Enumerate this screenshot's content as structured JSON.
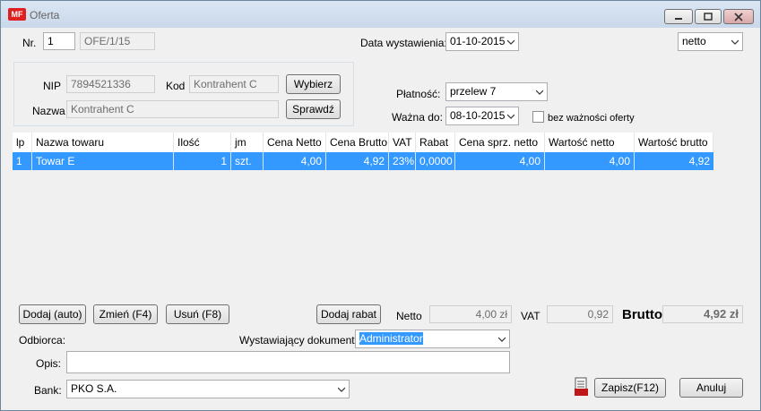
{
  "window": {
    "title": "Oferta",
    "app_icon": "MF"
  },
  "header": {
    "nr_label": "Nr.",
    "nr_value": "1",
    "doc_number": "OFE/1/15",
    "date_label": "Data wystawienia:",
    "date_value": "01-10-2015",
    "price_mode": "netto"
  },
  "contractor": {
    "nip_label": "NIP",
    "nip_value": "7894521336",
    "kod_label": "Kod",
    "kod_value": "Kontrahent C",
    "nazwa_label": "Nazwa",
    "nazwa_value": "Kontrahent C",
    "select_button": "Wybierz",
    "check_button": "Sprawdź"
  },
  "payment": {
    "label": "Płatność:",
    "value": "przelew 7",
    "valid_label": "Ważna do:",
    "valid_value": "08-10-2015",
    "no_expiry_label": "bez ważności oferty"
  },
  "table": {
    "columns": [
      "lp",
      "Nazwa towaru",
      "Ilość",
      "jm",
      "Cena Netto",
      "Cena Brutto",
      "VAT",
      "Rabat",
      "Cena sprz. netto",
      "Wartość netto",
      "Wartość brutto"
    ],
    "rows": [
      [
        "1",
        "Towar E",
        "1",
        "szt.",
        "4,00",
        "4,92",
        "23%",
        "0,0000",
        "4,00",
        "4,00",
        "4,92"
      ]
    ]
  },
  "actions": {
    "add_auto": "Dodaj (auto)",
    "edit": "Zmień (F4)",
    "delete": "Usuń (F8)",
    "add_discount": "Dodaj rabat"
  },
  "totals": {
    "netto_label": "Netto",
    "netto_value": "4,00 zł",
    "vat_label": "VAT",
    "vat_value": "0,92",
    "brutto_label": "Brutto",
    "brutto_value": "4,92 zł"
  },
  "footer": {
    "recipient_label": "Odbiorca:",
    "issuer_label": "Wystawiający dokument:",
    "issuer_value": "Administrator",
    "desc_label": "Opis:",
    "desc_value": "",
    "bank_label": "Bank:",
    "bank_value": "PKO S.A.",
    "save_button": "Zapisz(F12)",
    "cancel_button": "Anuluj"
  },
  "colors": {
    "selection": "#3399ff",
    "title_text": "#666666"
  }
}
